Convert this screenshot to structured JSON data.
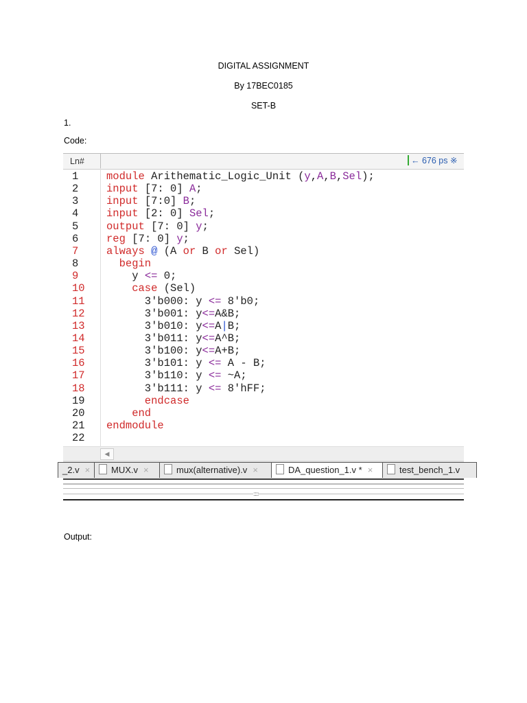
{
  "title": "DIGITAL ASSIGNMENT",
  "byline": "By 17BEC0185",
  "set": "SET-B",
  "question": "1.",
  "code_label": "Code:",
  "output_label": "Output:",
  "editor": {
    "ln_header": "Ln#",
    "time": "← 676 ps ※",
    "red_lines": [
      7,
      9,
      10,
      11,
      12,
      13,
      14,
      15,
      16,
      17,
      18
    ],
    "lines": [
      [
        [
          "module ",
          "k"
        ],
        [
          "Arithematic_Logic_Unit ",
          "n"
        ],
        [
          "(",
          "n"
        ],
        [
          "y",
          "p"
        ],
        [
          ",",
          "n"
        ],
        [
          "A",
          "p"
        ],
        [
          ",",
          "n"
        ],
        [
          "B",
          "p"
        ],
        [
          ",",
          "n"
        ],
        [
          "Sel",
          "p"
        ],
        [
          ");",
          "n"
        ]
      ],
      [
        [
          "input ",
          "k"
        ],
        [
          "[7: 0] ",
          "n"
        ],
        [
          "A",
          "p"
        ],
        [
          ";",
          "n"
        ]
      ],
      [
        [
          "input ",
          "k"
        ],
        [
          "[7:0] ",
          "n"
        ],
        [
          "B",
          "p"
        ],
        [
          ";",
          "n"
        ]
      ],
      [
        [
          "input ",
          "k"
        ],
        [
          "[2: 0] ",
          "n"
        ],
        [
          "Sel",
          "p"
        ],
        [
          ";",
          "n"
        ]
      ],
      [
        [
          "output ",
          "k"
        ],
        [
          "[7: 0] ",
          "n"
        ],
        [
          "y",
          "p"
        ],
        [
          ";",
          "n"
        ]
      ],
      [
        [
          "reg ",
          "k"
        ],
        [
          "[7: 0] ",
          "n"
        ],
        [
          "y",
          "p"
        ],
        [
          ";",
          "n"
        ]
      ],
      [
        [
          "always ",
          "k"
        ],
        [
          "@ ",
          "b"
        ],
        [
          "(A ",
          "n"
        ],
        [
          "or ",
          "k"
        ],
        [
          "B ",
          "n"
        ],
        [
          "or ",
          "k"
        ],
        [
          "Sel)",
          "n"
        ]
      ],
      [
        [
          "  begin",
          "k"
        ]
      ],
      [
        [
          "    y ",
          "n"
        ],
        [
          "<=",
          "p"
        ],
        [
          " 0;",
          "n"
        ]
      ],
      [
        [
          "    case ",
          "k"
        ],
        [
          "(Sel)",
          "n"
        ]
      ],
      [
        [
          "      3'b000: y ",
          "n"
        ],
        [
          "<=",
          "p"
        ],
        [
          " 8'b0;",
          "n"
        ]
      ],
      [
        [
          "      3'b001: y",
          "n"
        ],
        [
          "<=",
          "p"
        ],
        [
          "A&B;",
          "n"
        ]
      ],
      [
        [
          "      3'b010: y",
          "n"
        ],
        [
          "<=",
          "p"
        ],
        [
          "A",
          "n"
        ],
        [
          "|",
          "b"
        ],
        [
          "B;",
          "n"
        ]
      ],
      [
        [
          "      3'b011: y",
          "n"
        ],
        [
          "<=",
          "p"
        ],
        [
          "A^B;",
          "n"
        ]
      ],
      [
        [
          "      3'b100: y",
          "n"
        ],
        [
          "<=",
          "p"
        ],
        [
          "A+B;",
          "n"
        ]
      ],
      [
        [
          "      3'b101: y ",
          "n"
        ],
        [
          "<=",
          "p"
        ],
        [
          " A - B;",
          "n"
        ]
      ],
      [
        [
          "      3'b110: y ",
          "n"
        ],
        [
          "<=",
          "p"
        ],
        [
          " ~A;",
          "n"
        ]
      ],
      [
        [
          "      3'b111: y ",
          "n"
        ],
        [
          "<=",
          "p"
        ],
        [
          " 8'hFF;",
          "n"
        ]
      ],
      [
        [
          "      endcase",
          "k"
        ]
      ],
      [
        [
          "    end",
          "k"
        ]
      ],
      [
        [
          "endmodule",
          "k"
        ]
      ],
      [
        [
          "",
          "n"
        ]
      ]
    ],
    "tabs": [
      {
        "label": "_2.v",
        "close": "×",
        "active": false
      },
      {
        "label": "MUX.v",
        "close": "×",
        "active": false
      },
      {
        "label": "mux(alternative).v",
        "close": "×",
        "active": false
      },
      {
        "label": "DA_question_1.v *",
        "close": "×",
        "active": true
      },
      {
        "label": "test_bench_1.v",
        "close": "",
        "active": false
      }
    ]
  }
}
